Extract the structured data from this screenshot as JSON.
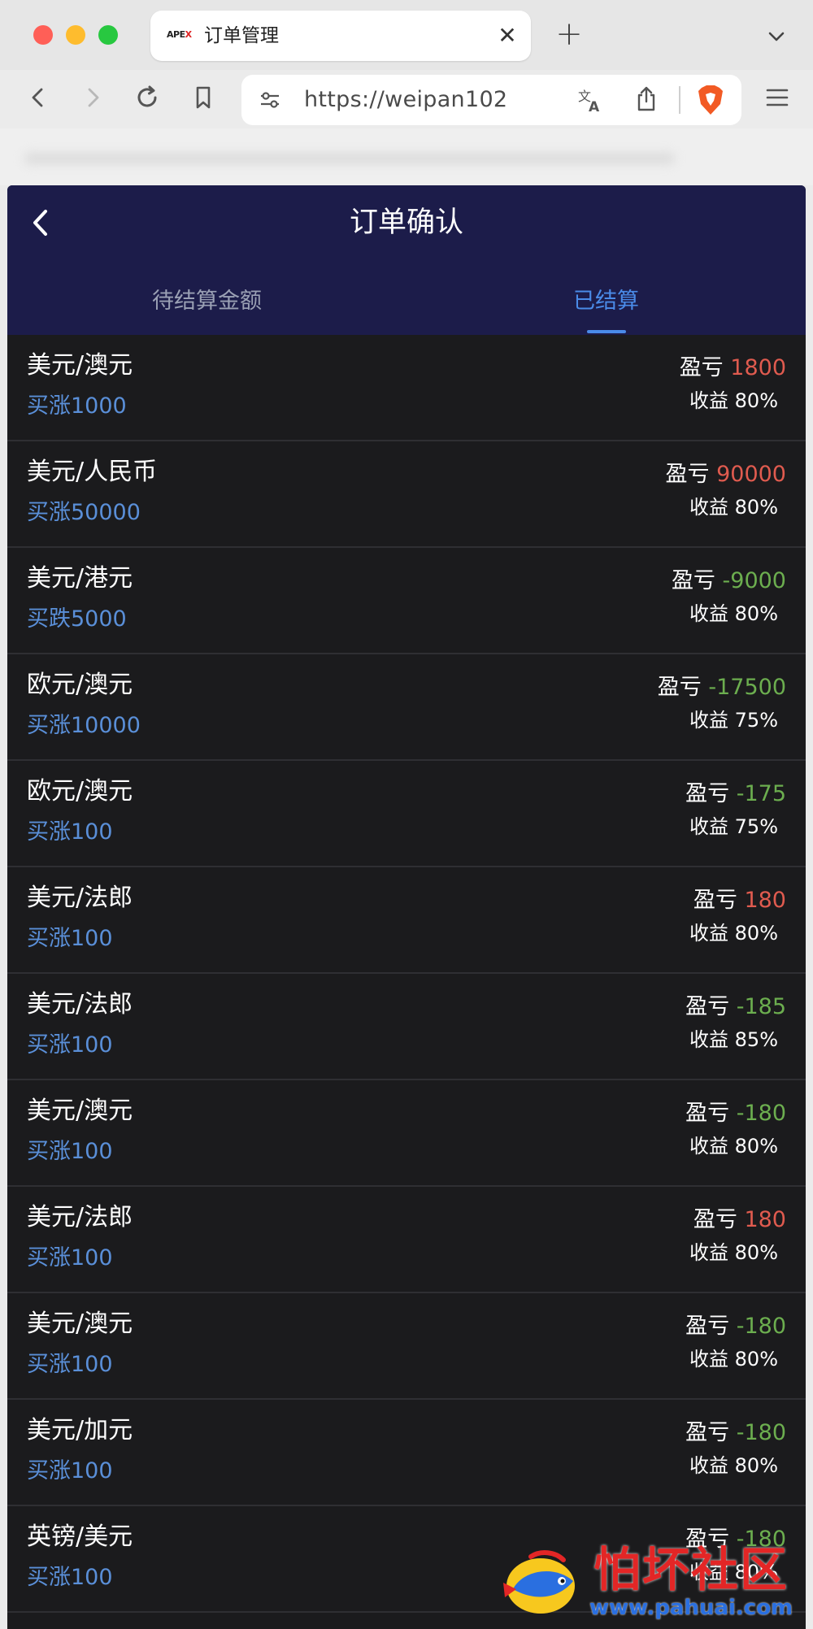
{
  "browser": {
    "tab_title": "订单管理",
    "favicon_text_a": "APE",
    "favicon_text_b": "X",
    "url": "https://weipan102"
  },
  "app": {
    "page_title": "订单确认",
    "tabs": [
      {
        "label": "待结算金额",
        "active": false
      },
      {
        "label": "已结算",
        "active": true
      }
    ],
    "pnl_label": "盈亏",
    "yield_label": "收益",
    "colors": {
      "profit": "#e05b4f",
      "loss": "#6cae4f",
      "accent": "#4a8be8",
      "header_bg": "#1c1c4a"
    },
    "orders": [
      {
        "pair": "美元/澳元",
        "trade": "买涨1000",
        "pnl": "1800",
        "pnl_sign": "pos",
        "yield": "80%"
      },
      {
        "pair": "美元/人民币",
        "trade": "买涨50000",
        "pnl": "90000",
        "pnl_sign": "pos",
        "yield": "80%"
      },
      {
        "pair": "美元/港元",
        "trade": "买跌5000",
        "pnl": "-9000",
        "pnl_sign": "neg",
        "yield": "80%"
      },
      {
        "pair": "欧元/澳元",
        "trade": "买涨10000",
        "pnl": "-17500",
        "pnl_sign": "neg",
        "yield": "75%"
      },
      {
        "pair": "欧元/澳元",
        "trade": "买涨100",
        "pnl": "-175",
        "pnl_sign": "neg",
        "yield": "75%"
      },
      {
        "pair": "美元/法郎",
        "trade": "买涨100",
        "pnl": "180",
        "pnl_sign": "pos",
        "yield": "80%"
      },
      {
        "pair": "美元/法郎",
        "trade": "买涨100",
        "pnl": "-185",
        "pnl_sign": "neg",
        "yield": "85%"
      },
      {
        "pair": "美元/澳元",
        "trade": "买涨100",
        "pnl": "-180",
        "pnl_sign": "neg",
        "yield": "80%"
      },
      {
        "pair": "美元/法郎",
        "trade": "买涨100",
        "pnl": "180",
        "pnl_sign": "pos",
        "yield": "80%"
      },
      {
        "pair": "美元/澳元",
        "trade": "买涨100",
        "pnl": "-180",
        "pnl_sign": "neg",
        "yield": "80%"
      },
      {
        "pair": "美元/加元",
        "trade": "买涨100",
        "pnl": "-180",
        "pnl_sign": "neg",
        "yield": "80%"
      },
      {
        "pair": "英镑/美元",
        "trade": "买涨100",
        "pnl": "-180",
        "pnl_sign": "neg",
        "yield": "80%"
      }
    ]
  },
  "watermark": {
    "text": "怕坏社区",
    "url": "www.pahuai.com"
  }
}
